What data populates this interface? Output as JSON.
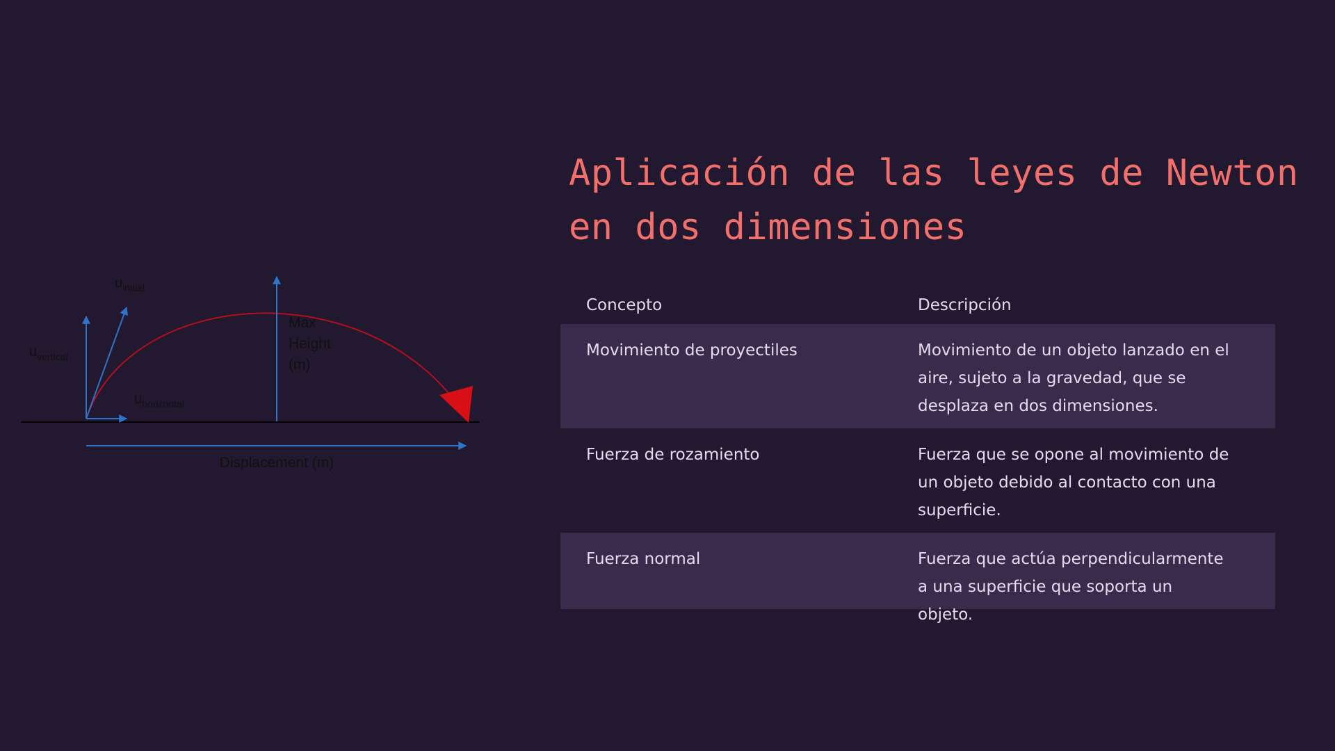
{
  "slide": {
    "title_line1": "Aplicación de las leyes de Newton",
    "title_line2": "en dos dimensiones"
  },
  "diagram": {
    "label_initial_base": "u",
    "label_initial_sub": "initial",
    "label_vertical_base": "u",
    "label_vertical_sub": "vertical",
    "label_horizontal_base": "u",
    "label_horizontal_sub": "horizontal",
    "label_max_line1": "Max",
    "label_max_line2": "Height",
    "label_max_line3": "(m)",
    "label_displacement": "Displacement (m)",
    "colors": {
      "trajectory": "#b0101c",
      "vectors": "#2e74c8",
      "ground": "#000000",
      "text": "#111111"
    }
  },
  "table": {
    "headers": [
      "Concepto",
      "Descripción"
    ],
    "rows": [
      {
        "concept": "Movimiento de proyectiles",
        "desc_lines": [
          "Movimiento de un objeto lanzado en el",
          "aire, sujeto a la gravedad, que se",
          "desplaza en dos dimensiones."
        ]
      },
      {
        "concept": "Fuerza de rozamiento",
        "desc_lines": [
          "Fuerza que se opone al movimiento de",
          "un objeto debido al contacto con una",
          "superficie."
        ]
      },
      {
        "concept": "Fuerza normal",
        "desc_lines": [
          "Fuerza que actúa perpendicularmente",
          "a una superficie que soporta un",
          "objeto."
        ]
      }
    ]
  },
  "theme": {
    "background": "#221830",
    "title_color": "#f2706c",
    "row_highlight": "#3a2a4c",
    "text_color": "#e4dcee"
  }
}
